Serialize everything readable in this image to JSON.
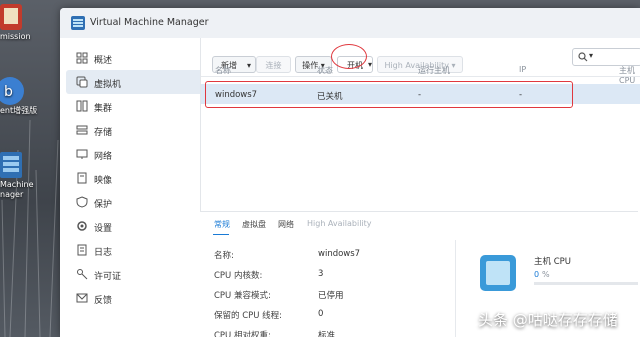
{
  "desktop": {
    "icons": [
      {
        "label": "mission"
      },
      {
        "label": "ent增强版"
      },
      {
        "label": "Machine\nnager"
      }
    ]
  },
  "window": {
    "title": "Virtual Machine Manager"
  },
  "sidebar": {
    "items": [
      {
        "label": "概述",
        "icon": "overview-icon"
      },
      {
        "label": "虚拟机",
        "icon": "vm-icon"
      },
      {
        "label": "集群",
        "icon": "cluster-icon"
      },
      {
        "label": "存储",
        "icon": "storage-icon"
      },
      {
        "label": "网络",
        "icon": "network-icon"
      },
      {
        "label": "映像",
        "icon": "image-icon"
      },
      {
        "label": "保护",
        "icon": "shield-icon"
      },
      {
        "label": "设置",
        "icon": "gear-icon"
      },
      {
        "label": "日志",
        "icon": "log-icon"
      },
      {
        "label": "许可证",
        "icon": "key-icon"
      },
      {
        "label": "反馈",
        "icon": "mail-icon"
      }
    ],
    "active_index": 1
  },
  "toolbar": {
    "new_label": "新增",
    "connect_label": "连接",
    "action_label": "操作",
    "power_on_label": "开机",
    "ha_label": "High Availability"
  },
  "table": {
    "headers": [
      "名称",
      "状态",
      "运行主机",
      "IP",
      "主机 CPU"
    ],
    "rows": [
      {
        "name": "windows7",
        "status": "已关机",
        "host": "-",
        "ip": "-"
      }
    ]
  },
  "details": {
    "tabs": [
      "常规",
      "虚拟盘",
      "网络",
      "High Availability"
    ],
    "fields": [
      {
        "label": "名称:",
        "value": "windows7"
      },
      {
        "label": "CPU 内核数:",
        "value": "3"
      },
      {
        "label": "CPU 兼容模式:",
        "value": "已停用"
      },
      {
        "label": "保留的 CPU 线程:",
        "value": "0"
      },
      {
        "label": "CPU 相对权重:",
        "value": "标准"
      }
    ],
    "cpu": {
      "title": "主机 CPU",
      "value": "0",
      "unit": "%"
    }
  },
  "watermark": "头条 @咕哒存存存储",
  "colors": {
    "accent": "#1a7bd6",
    "highlight": "#e0383e",
    "row_selected": "#dce8f5"
  }
}
